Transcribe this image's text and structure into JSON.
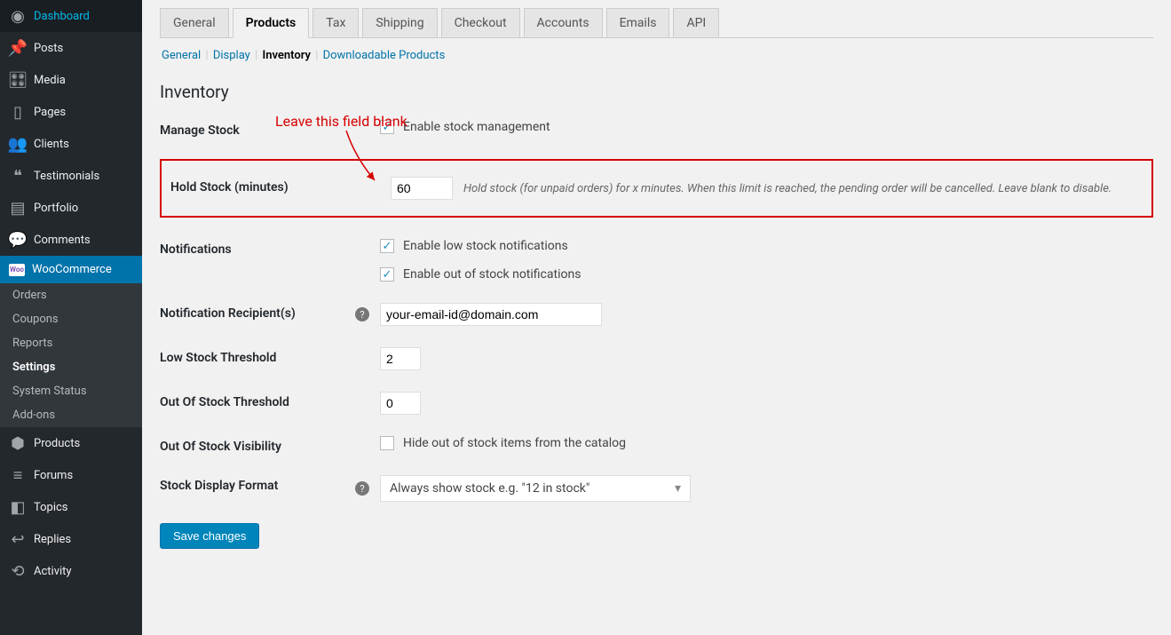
{
  "sidebar": {
    "items": [
      {
        "icon": "dashboard",
        "label": "Dashboard"
      },
      {
        "icon": "pin",
        "label": "Posts"
      },
      {
        "icon": "media",
        "label": "Media"
      },
      {
        "icon": "page",
        "label": "Pages"
      },
      {
        "icon": "users",
        "label": "Clients"
      },
      {
        "icon": "quote",
        "label": "Testimonials"
      },
      {
        "icon": "image",
        "label": "Portfolio"
      },
      {
        "icon": "comment",
        "label": "Comments"
      },
      {
        "icon": "woo",
        "label": "WooCommerce",
        "current": true
      },
      {
        "icon": "product",
        "label": "Products"
      },
      {
        "icon": "forum",
        "label": "Forums"
      },
      {
        "icon": "topic",
        "label": "Topics"
      },
      {
        "icon": "reply",
        "label": "Replies"
      },
      {
        "icon": "activity",
        "label": "Activity"
      }
    ],
    "sub": [
      {
        "label": "Orders"
      },
      {
        "label": "Coupons"
      },
      {
        "label": "Reports"
      },
      {
        "label": "Settings",
        "current": true
      },
      {
        "label": "System Status"
      },
      {
        "label": "Add-ons"
      }
    ]
  },
  "tabs": [
    "General",
    "Products",
    "Tax",
    "Shipping",
    "Checkout",
    "Accounts",
    "Emails",
    "API"
  ],
  "active_tab": "Products",
  "subtabs": [
    "General",
    "Display",
    "Inventory",
    "Downloadable Products"
  ],
  "active_subtab": "Inventory",
  "heading": "Inventory",
  "annotation": "Leave this field blank",
  "rows": {
    "manage_stock": {
      "label": "Manage Stock",
      "cb": "Enable stock management",
      "checked": true
    },
    "hold_stock": {
      "label": "Hold Stock (minutes)",
      "value": "60",
      "desc": "Hold stock (for unpaid orders) for x minutes. When this limit is reached, the pending order will be cancelled. Leave blank to disable."
    },
    "notifications": {
      "label": "Notifications",
      "cb1": "Enable low stock notifications",
      "cb1_checked": true,
      "cb2": "Enable out of stock notifications",
      "cb2_checked": true
    },
    "recipient": {
      "label": "Notification Recipient(s)",
      "value": "your-email-id@domain.com"
    },
    "low_thresh": {
      "label": "Low Stock Threshold",
      "value": "2"
    },
    "oos_thresh": {
      "label": "Out Of Stock Threshold",
      "value": "0"
    },
    "oos_vis": {
      "label": "Out Of Stock Visibility",
      "cb": "Hide out of stock items from the catalog",
      "checked": false
    },
    "display_fmt": {
      "label": "Stock Display Format",
      "value": "Always show stock e.g. \"12 in stock\""
    }
  },
  "save_label": "Save changes",
  "icons": {
    "dashboard": "◉",
    "pin": "📌",
    "media": "🎛",
    "page": "▯",
    "users": "👥",
    "quote": "❝",
    "image": "▤",
    "comment": "💬",
    "woo": "W",
    "product": "⬢",
    "forum": "≡",
    "topic": "◧",
    "reply": "↩",
    "activity": "⟲"
  }
}
